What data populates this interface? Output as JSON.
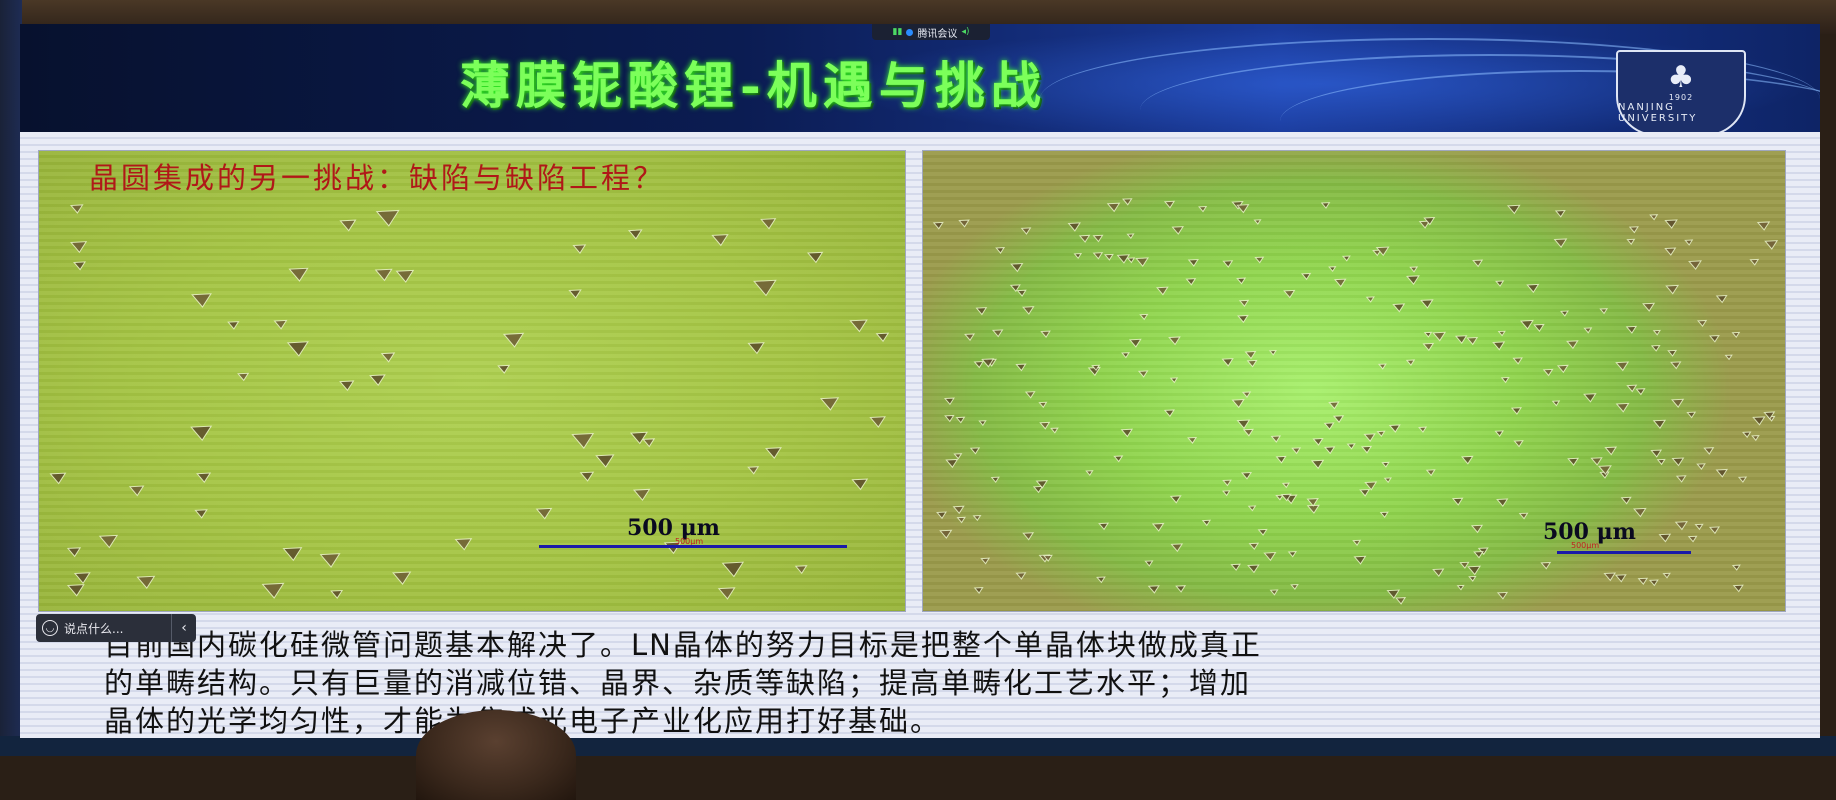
{
  "meeting_app": {
    "name": "腾讯会议",
    "comment_placeholder": "说点什么...",
    "collapse_glyph": "‹"
  },
  "slide": {
    "title": "薄膜铌酸锂-机遇与挑战",
    "logo": {
      "year": "1902",
      "name": "NANJING UNIVERSITY"
    },
    "left_image": {
      "question": "晶圆集成的另一挑战：缺陷与缺陷工程？",
      "scale_label": "500 μm",
      "scale_tiny": "500μm"
    },
    "right_image": {
      "scale_label": "500 μm",
      "scale_tiny": "500μm"
    },
    "conclusion_lines": [
      "目前国内碳化硅微管问题基本解决了。LN晶体的努力目标是把整个单晶体块做成真正",
      "的单畴结构。只有巨量的消减位错、晶界、杂质等缺陷；提高单畴化工艺水平；增加",
      "晶体的光学均匀性，才能为集成光电子产业化应用打好基础。"
    ]
  },
  "colors": {
    "title_green": "#7cff5a",
    "question_red": "#b01818",
    "scale_bar_blue": "#1a1aa8"
  }
}
